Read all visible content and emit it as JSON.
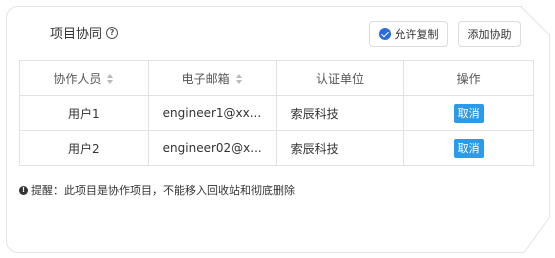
{
  "header": {
    "title": "项目协同",
    "help_icon": "question-circle-icon",
    "allow_copy_label": "允许复制",
    "allow_copy_checked": true,
    "add_collab_label": "添加协助"
  },
  "table": {
    "columns": [
      "协作人员",
      "电子邮箱",
      "认证单位",
      "操作"
    ],
    "rows": [
      {
        "user": "用户1",
        "email": "engineer1@xx...",
        "unit": "索辰科技",
        "action": "取消"
      },
      {
        "user": "用户2",
        "email": "engineer02@x...",
        "unit": "索辰科技",
        "action": "取消"
      }
    ]
  },
  "notice": {
    "icon": "exclamation-circle-icon",
    "text": "提醒：此项目是协作项目，不能移入回收站和彻底删除"
  },
  "colors": {
    "accent": "#2b6cde",
    "cancel_button": "#2b9ae8",
    "border": "#e2e2e2"
  }
}
